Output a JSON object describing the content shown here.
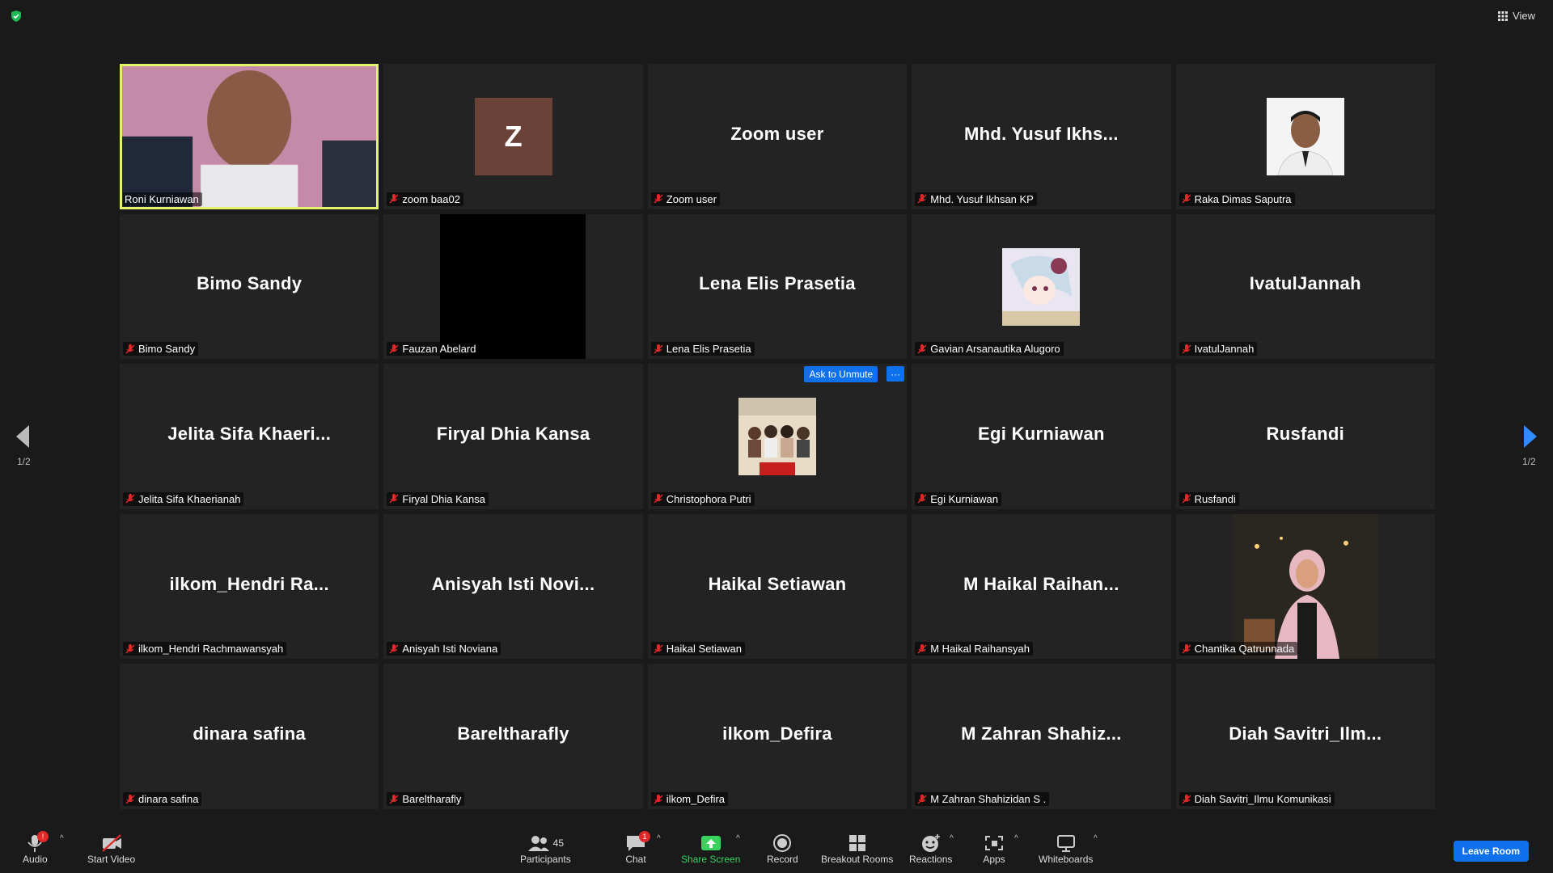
{
  "view_label": "View",
  "page_indicator_left": "1/2",
  "page_indicator_right": "1/2",
  "participants": [
    {
      "display": "",
      "tag": "Roni Kurniawan",
      "kind": "video-person",
      "active": true
    },
    {
      "display": "Z",
      "tag": "zoom baa02",
      "kind": "letter"
    },
    {
      "display": "Zoom user",
      "tag": "Zoom user",
      "kind": "text"
    },
    {
      "display": "Mhd. Yusuf Ikhs...",
      "tag": "Mhd. Yusuf Ikhsan KP",
      "kind": "text"
    },
    {
      "display": "",
      "tag": "Raka Dimas Saputra",
      "kind": "photo-portrait"
    },
    {
      "display": "Bimo Sandy",
      "tag": "Bimo Sandy",
      "kind": "text"
    },
    {
      "display": "",
      "tag": "Fauzan Abelard",
      "kind": "black-video"
    },
    {
      "display": "Lena Elis Prasetia",
      "tag": "Lena Elis Prasetia",
      "kind": "text"
    },
    {
      "display": "",
      "tag": "Gavian Arsanautika Alugoro",
      "kind": "photo-anime"
    },
    {
      "display": "IvatulJannah",
      "tag": "IvatulJannah",
      "kind": "text"
    },
    {
      "display": "Jelita Sifa Khaeri...",
      "tag": "Jelita Sifa Khaerianah",
      "kind": "text"
    },
    {
      "display": "Firyal Dhia Kansa",
      "tag": "Firyal Dhia Kansa",
      "kind": "text"
    },
    {
      "display": "",
      "tag": "Christophora Putri",
      "kind": "photo-group",
      "hover": true
    },
    {
      "display": "Egi Kurniawan",
      "tag": "Egi Kurniawan",
      "kind": "text"
    },
    {
      "display": "Rusfandi",
      "tag": "Rusfandi",
      "kind": "text"
    },
    {
      "display": "ilkom_Hendri Ra...",
      "tag": "ilkom_Hendri Rachmawansyah",
      "kind": "text"
    },
    {
      "display": "Anisyah Isti Novi...",
      "tag": "Anisyah Isti Noviana",
      "kind": "text"
    },
    {
      "display": "Haikal Setiawan",
      "tag": "Haikal Setiawan",
      "kind": "text"
    },
    {
      "display": "M Haikal Raihan...",
      "tag": "M Haikal Raihansyah",
      "kind": "text"
    },
    {
      "display": "",
      "tag": "Chantika Qatrunnada",
      "kind": "video-woman"
    },
    {
      "display": "dinara safina",
      "tag": "dinara safina",
      "kind": "text"
    },
    {
      "display": "Bareltharafly",
      "tag": "Bareltharafly",
      "kind": "text"
    },
    {
      "display": "ilkom_Defira",
      "tag": "ilkom_Defira",
      "kind": "text"
    },
    {
      "display": "M Zahran Shahiz...",
      "tag": "M Zahran Shahizidan S .",
      "kind": "text"
    },
    {
      "display": "Diah Savitri_Ilm...",
      "tag": "Diah Savitri_Ilmu Komunikasi",
      "kind": "text"
    }
  ],
  "hover_actions": {
    "ask_unmute": "Ask to Unmute",
    "more": "···"
  },
  "toolbar": {
    "audio": "Audio",
    "audio_badge": "!",
    "start_video": "Start Video",
    "participants": "Participants",
    "participants_count": "45",
    "chat": "Chat",
    "chat_badge": "1",
    "share_screen": "Share Screen",
    "record": "Record",
    "breakout_rooms": "Breakout Rooms",
    "reactions": "Reactions",
    "apps": "Apps",
    "whiteboards": "Whiteboards",
    "leave_room": "Leave Room"
  },
  "colors": {
    "active_speaker": "#e3f26b",
    "accent": "#0e71eb",
    "mute": "#e02828",
    "share": "#3ad25f"
  }
}
